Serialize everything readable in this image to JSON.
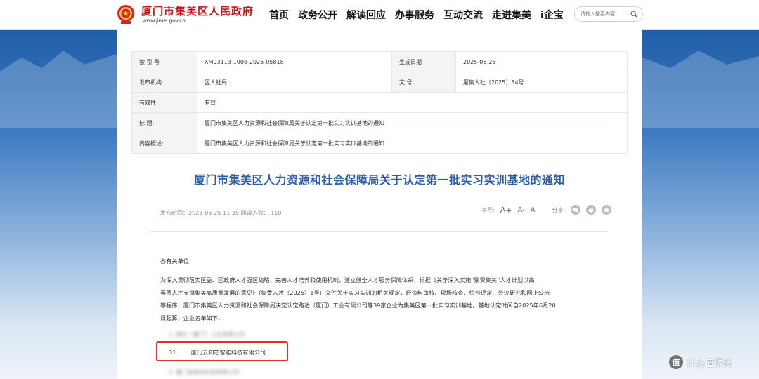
{
  "header": {
    "site_title": "厦门市集美区人民政府",
    "site_domain": "www.jimei.gov.cn",
    "nav": [
      "首页",
      "政务公开",
      "解读回应",
      "办事服务",
      "互动交流",
      "走进集美",
      "i企宝"
    ],
    "search_placeholder": "请输入搜索内容",
    "icons": {
      "emblem": "national-emblem-icon",
      "search": "search-icon"
    },
    "brand_color": "#c4161c"
  },
  "meta": {
    "index_label": "索 引 号",
    "index_value": "XM03113-1008-2025-05818",
    "date_label": "生成日期",
    "date_value": "2025-06-25",
    "agency_label": "发布机构",
    "agency_value": "区人社局",
    "docno_label": "文 号",
    "docno_value": "厦集人社〔2025〕34号",
    "validity_label": "有效性:",
    "validity_value": "有效",
    "title_label": "标 题:",
    "title_value": "厦门市集美区人力资源和社会保障局关于认定第一批实习实训基地的通知",
    "summary_label": "内容概述:",
    "summary_value": "厦门市集美区人力资源和社会保障局关于认定第一批实习实训基地的通知"
  },
  "article": {
    "title": "厦门市集美区人力资源和社会保障局关于认定第一批实习实训基地的通知",
    "title_color": "#2e5fa6",
    "info": "发布时间：2025-06-25 11:35 阅读人数： 110",
    "font_label": "字号:",
    "font_big": "A+",
    "font_mid": "A-",
    "font_small": "A",
    "share_label": "分享:",
    "share_icons": [
      "wechat-icon",
      "weibo-icon",
      "qzone-icon"
    ],
    "greeting": "各有关单位:",
    "para_lines": [
      "为深入贯彻落实区委、区政府人才强区战略，完善人才培养和使用机制，建立健全人才服务保障体系，根据《关于深入实施“聚贤集美”人才计划以高",
      "素质人才支撑集美高质量发展的意见》（集委人才〔2025〕1号）文件关于实习实训的相关规定，经资料审核、现场核查、综合评定、会议研究和网上公示",
      "等程序，厦门市集美区人力资源和社会保障局决定认定路达（厦门）工业有限公司等39家企业为集美区第一批实习实训基地。基地认定时间自2025年6月20",
      "日起算，企业名单如下："
    ],
    "list_blurred_1": "1.    路达（厦门）工业有限公司",
    "list_num": "31.",
    "list_name": "厦门云知芯智能科技有限公司",
    "list_blurred_2": "4.    厦门金银岛科技有限公司",
    "highlight_color": "#e0302a"
  },
  "watermark": {
    "logo": "值",
    "text": "什么值得买"
  }
}
